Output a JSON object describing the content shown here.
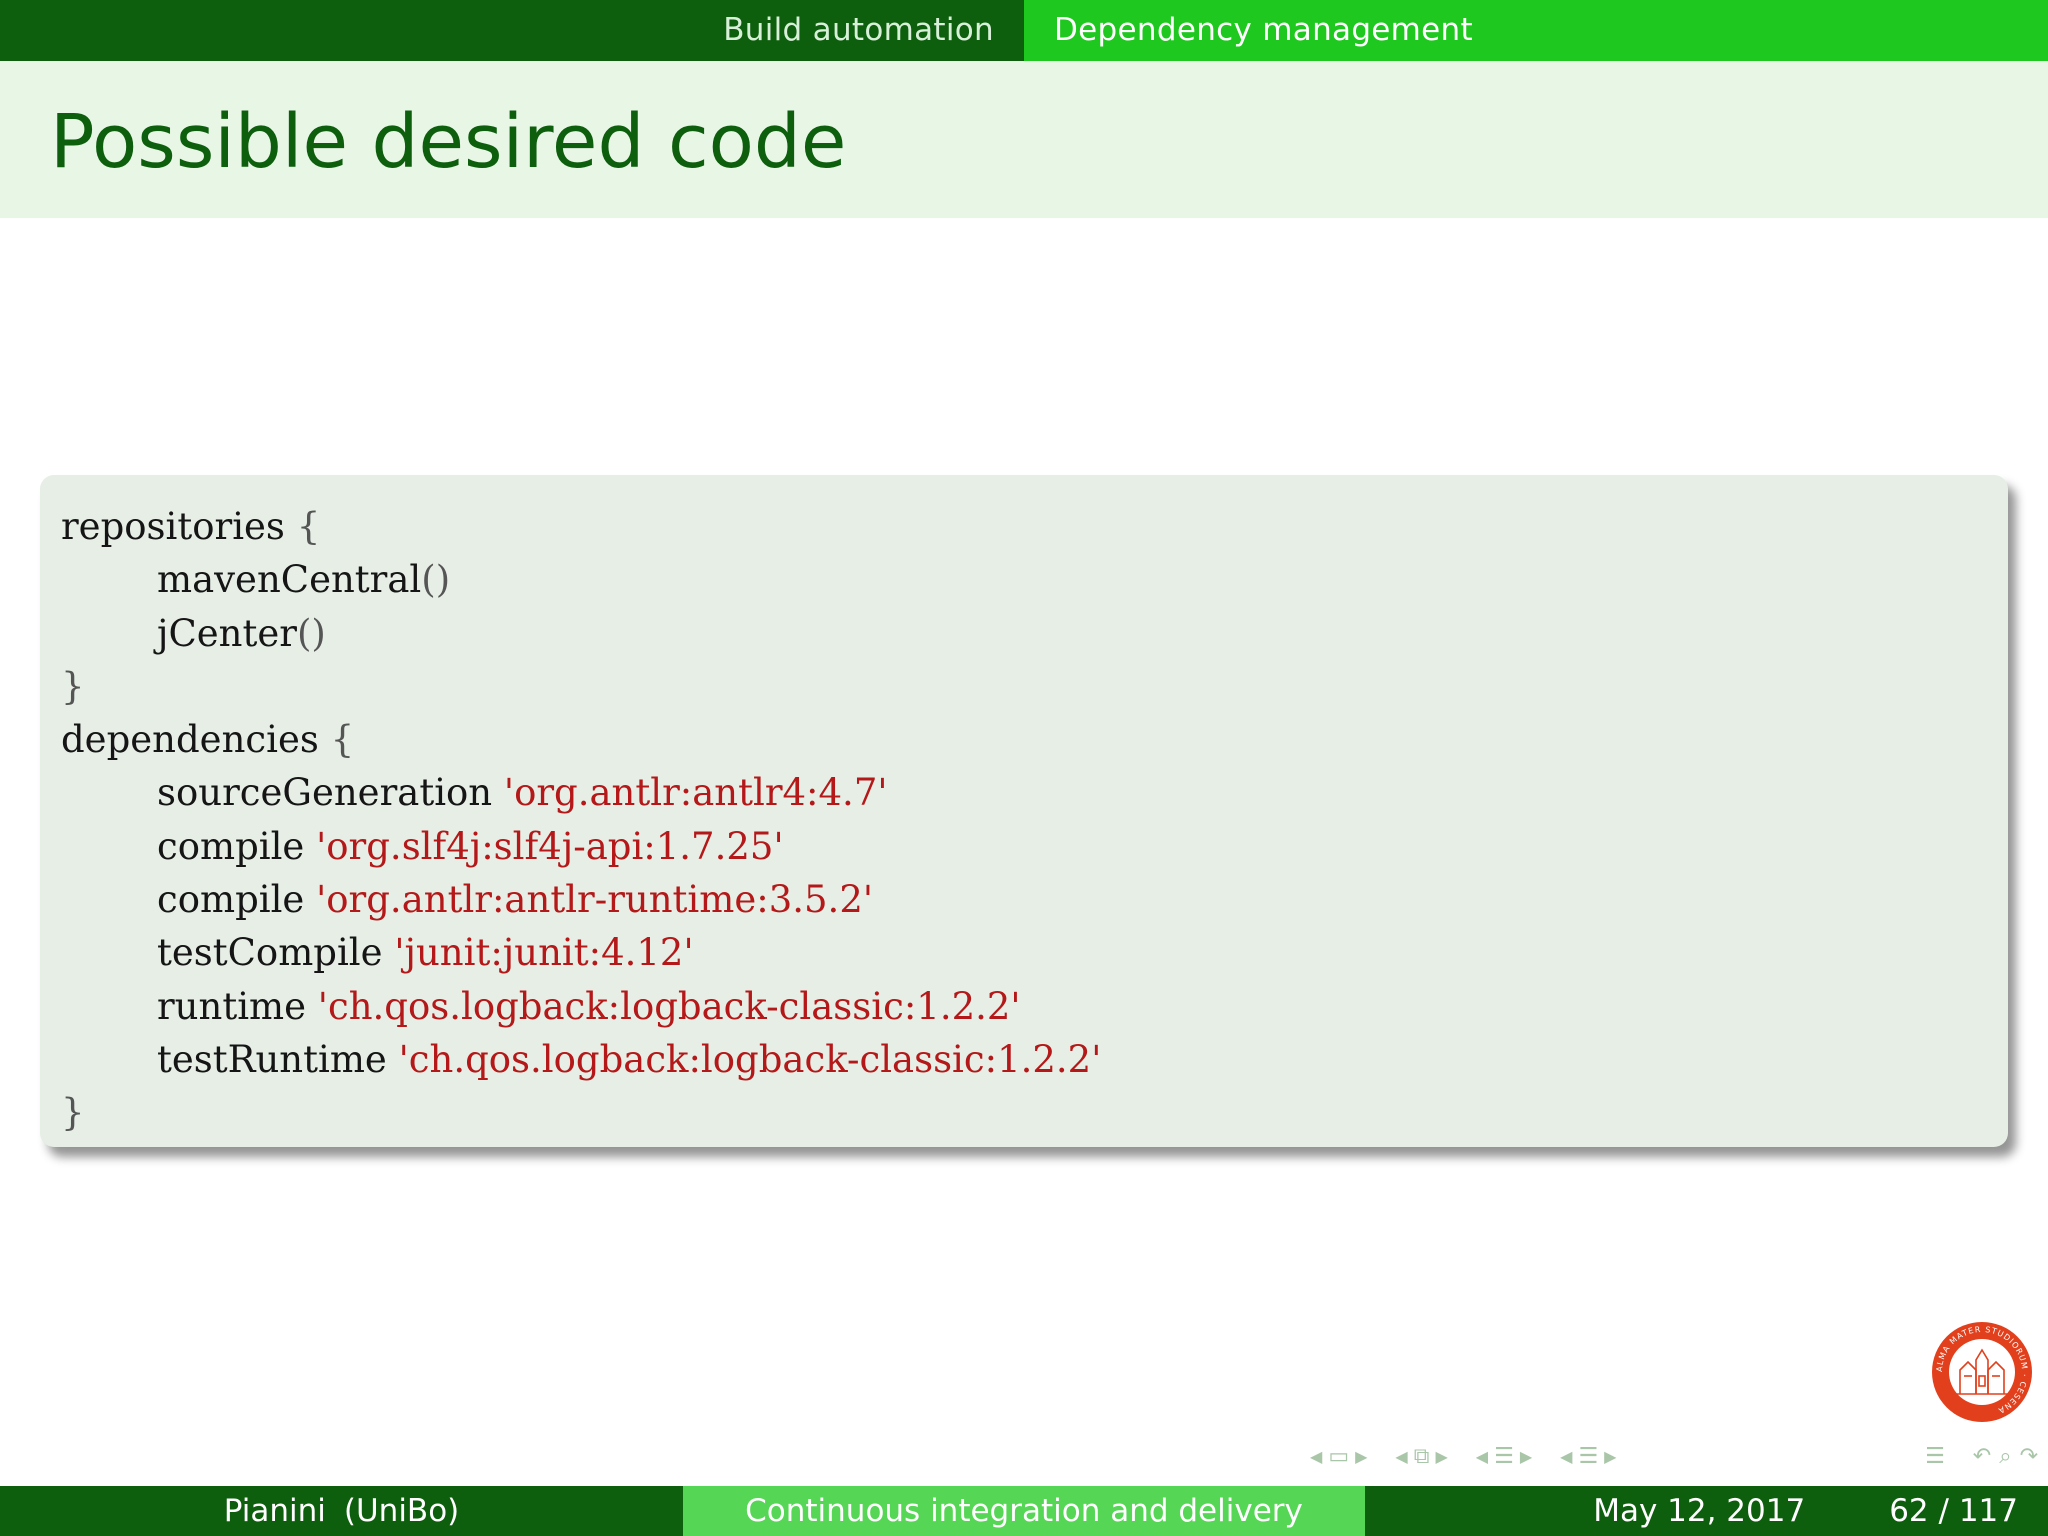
{
  "nav": {
    "section": "Build automation",
    "subsection": "Dependency management"
  },
  "title": "Possible desired code",
  "code": {
    "line1": {
      "kw": "repositories",
      "brace": "{"
    },
    "line2": {
      "kw": "mavenCentral",
      "paren": "()"
    },
    "line3": {
      "kw": "jCenter",
      "paren": "()"
    },
    "line4": {
      "brace": "}"
    },
    "line5": {
      "kw": "dependencies",
      "brace": "{"
    },
    "line6": {
      "kw": "sourceGeneration",
      "str": "'org.antlr:antlr4:4.7'"
    },
    "line7": {
      "kw": "compile",
      "str": "'org.slf4j:slf4j-api:1.7.25'"
    },
    "line8": {
      "kw": "compile",
      "str": "'org.antlr:antlr-runtime:3.5.2'"
    },
    "line9": {
      "kw": "testCompile",
      "str": "'junit:junit:4.12'"
    },
    "line10": {
      "kw": "runtime",
      "str": "'ch.qos.logback:logback-classic:1.2.2'"
    },
    "line11": {
      "kw": "testRuntime",
      "str": "'ch.qos.logback:logback-classic:1.2.2'"
    },
    "line12": {
      "brace": "}"
    }
  },
  "logo": {
    "icon": "university-seal-icon",
    "ring_text": "ALMA MATER STUDIORUM · CESENA",
    "color": "#e2401c"
  },
  "navigation_symbols": [
    "slide-nav-icon",
    "frame-nav-icon",
    "subsection-nav-icon",
    "section-nav-icon",
    "toc-icon",
    "back-icon",
    "search-icon",
    "forward-icon"
  ],
  "footer": {
    "author": "Pianini",
    "institute": "(UniBo)",
    "short_title": "Continuous integration and delivery",
    "date": "May 12, 2017",
    "page_current": "62",
    "page_sep": "/",
    "page_total": "117"
  },
  "colors": {
    "dark_green": "#0d5e0d",
    "bright_green": "#1ec81e",
    "light_green": "#55d655",
    "title_band": "#e8f6e6",
    "code_bg": "#e6eee6",
    "string_red": "#b41818"
  }
}
